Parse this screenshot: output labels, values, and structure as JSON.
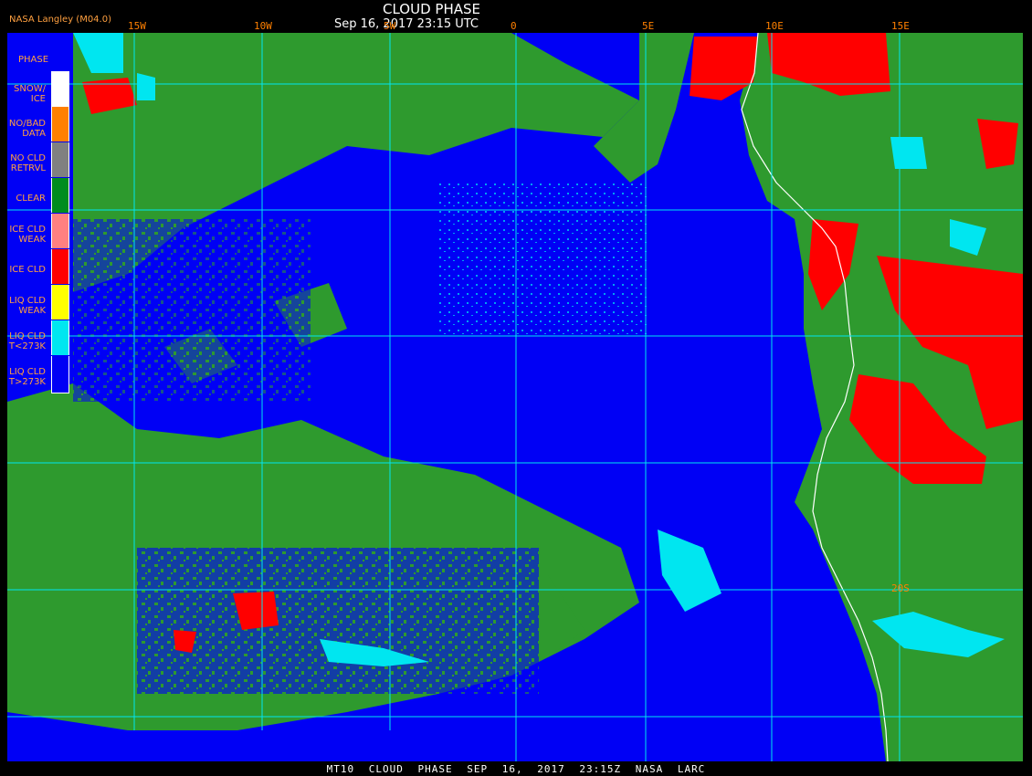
{
  "header": {
    "title": "CLOUD PHASE",
    "timestamp": "Sep 16, 2017 23:15 UTC",
    "source": "NASA Langley (M04.0)"
  },
  "footer": {
    "caption": "MT10 CLOUD PHASE SEP 16, 2017 23:15Z NASA LARC"
  },
  "longitude_ticks": [
    "15W",
    "10W",
    "5W",
    "0",
    "5E",
    "10E",
    "15E"
  ],
  "latitude_ticks": [
    "20S"
  ],
  "legend": {
    "title": "PHASE",
    "items": [
      {
        "label": "SNOW/\nICE",
        "color": "#ffffff"
      },
      {
        "label": "NO/BAD\nDATA",
        "color": "#ff8000"
      },
      {
        "label": "NO CLD\nRETRVL",
        "color": "#808080"
      },
      {
        "label": "CLEAR",
        "color": "#008c1e"
      },
      {
        "label": "ICE CLD\nWEAK",
        "color": "#ff8080"
      },
      {
        "label": "ICE CLD",
        "color": "#ff0000"
      },
      {
        "label": "LIQ CLD\nWEAK",
        "color": "#ffff00"
      },
      {
        "label": "LIQ CLD\nT<273K",
        "color": "#00e6f0"
      },
      {
        "label": "LIQ CLD\nT>273K",
        "color": "#0000f5"
      }
    ]
  },
  "colors": {
    "ocean_liquid_cloud": "#0000f5",
    "clear": "#2e9a2e",
    "ice_cloud": "#ff0000",
    "cold_liquid_cloud": "#00e6f0",
    "grid": "#00e6f0",
    "coastline": "#ffffff",
    "label_text": "#ffa040"
  }
}
